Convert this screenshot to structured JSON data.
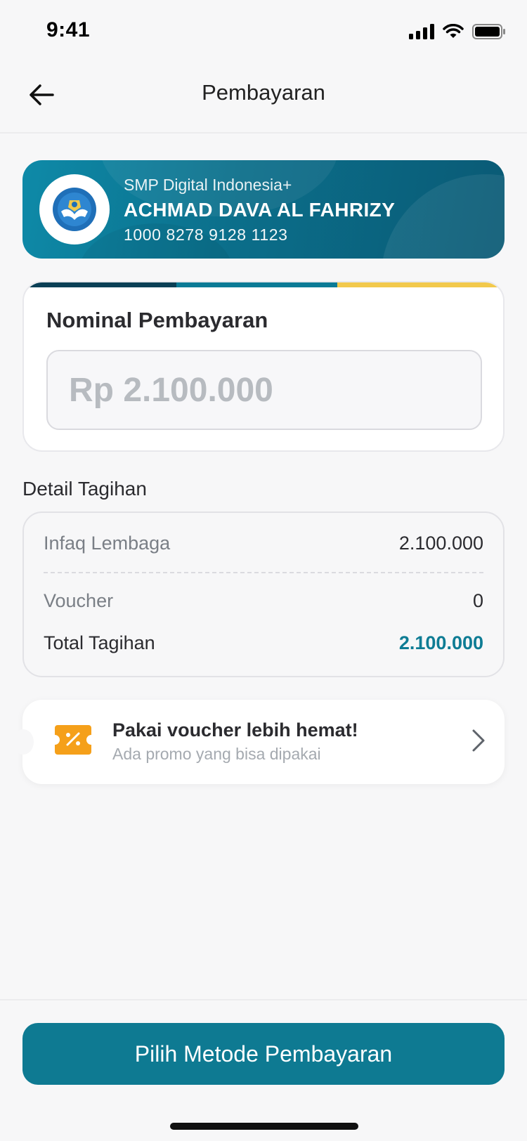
{
  "status_bar": {
    "time": "9:41"
  },
  "header": {
    "title": "Pembayaran"
  },
  "banner": {
    "school_name": "SMP Digital Indonesia+",
    "student_name": "ACHMAD DAVA AL FAHRIZY",
    "student_id": "1000 8278 9128 1123"
  },
  "nominal": {
    "title": "Nominal Pembayaran",
    "placeholder": "Rp 2.100.000"
  },
  "detail": {
    "label": "Detail Tagihan",
    "rows": [
      {
        "label": "Infaq Lembaga",
        "value": "2.100.000"
      },
      {
        "label": "Voucher",
        "value": "0"
      },
      {
        "label": "Total Tagihan",
        "value": "2.100.000"
      }
    ]
  },
  "voucher": {
    "title": "Pakai voucher lebih hemat!",
    "subtitle": "Ada promo yang bisa dipakai"
  },
  "footer": {
    "pay_button": "Pilih Metode Pembayaran"
  },
  "colors": {
    "primary": "#0E7A92",
    "accent_total": "#0E7C94",
    "voucher_icon": "#F5A01A",
    "strip_dark": "#0A3F55",
    "strip_mid": "#0B7A95",
    "strip_yellow": "#F2C94C"
  }
}
